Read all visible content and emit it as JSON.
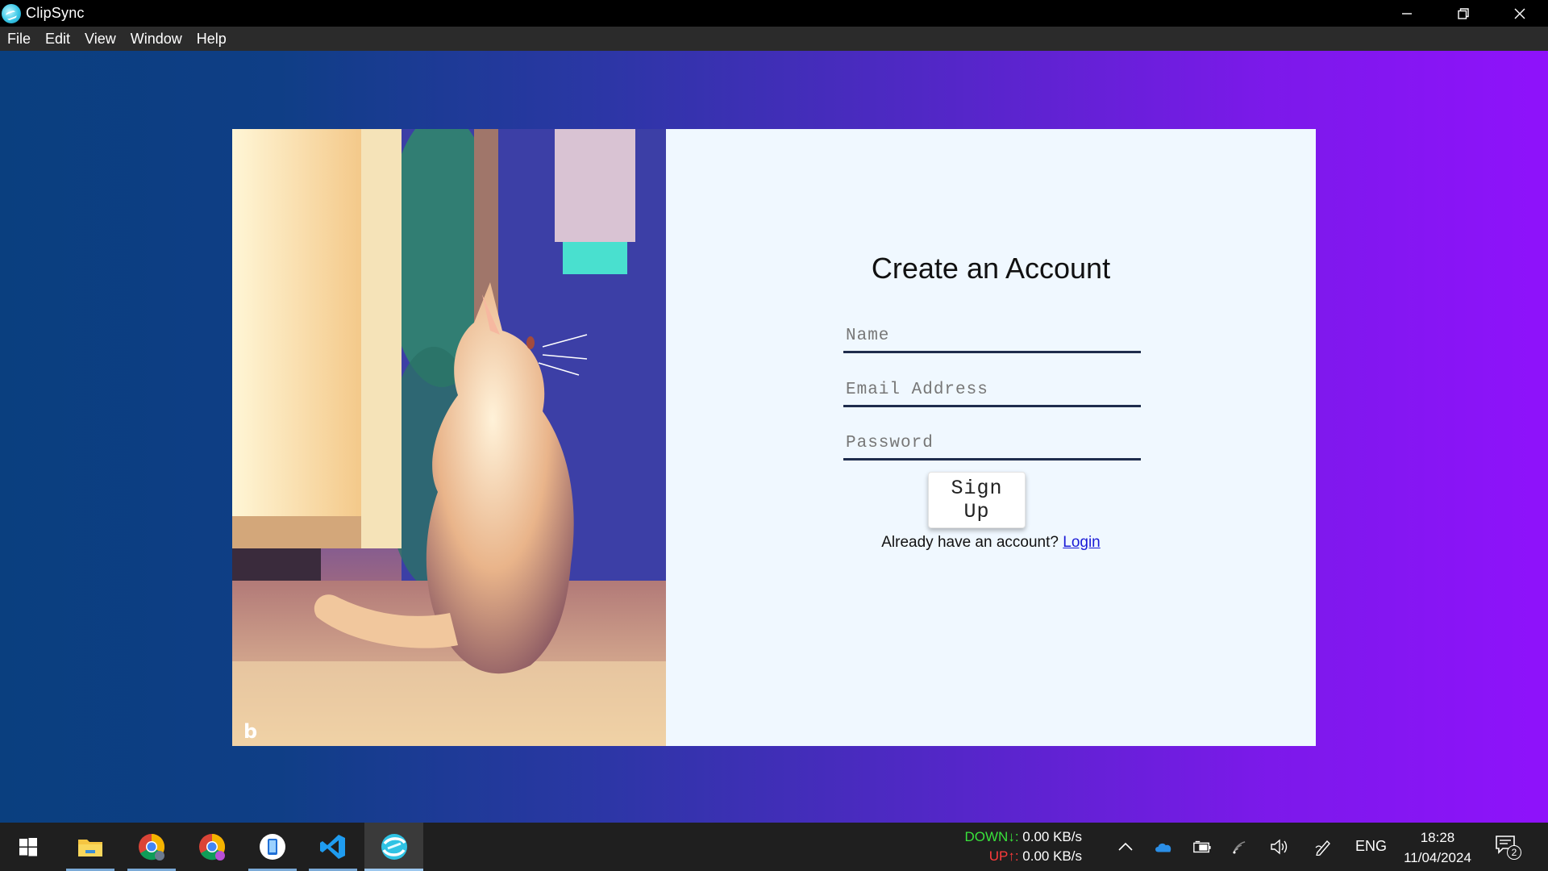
{
  "window": {
    "title": "ClipSync"
  },
  "menu": [
    "File",
    "Edit",
    "View",
    "Window",
    "Help"
  ],
  "form": {
    "title": "Create an Account",
    "name_placeholder": "Name",
    "email_placeholder": "Email Address",
    "password_placeholder": "Password",
    "submit_label": "Sign Up",
    "login_prompt": "Already have an account?",
    "login_link": "Login"
  },
  "taskbar": {
    "apps": [
      "start-icon",
      "file-explorer-icon",
      "chrome-icon",
      "chrome-icon",
      "phone-link-icon",
      "vscode-icon",
      "clipsync-icon"
    ],
    "net_down_label": "DOWN↓:",
    "net_down_value": "0.00 KB/s",
    "net_up_label": "UP↑:",
    "net_up_value": "0.00 KB/s",
    "language": "ENG",
    "time": "18:28",
    "date": "11/04/2024",
    "notification_count": "2"
  },
  "colors": {
    "gradient_start": "#0a3f7f",
    "gradient_end": "#8f12fb",
    "card_bg": "#f0f8ff",
    "link": "#1a1ad6",
    "net_down": "#39e23b",
    "net_up": "#ff3b3b"
  }
}
